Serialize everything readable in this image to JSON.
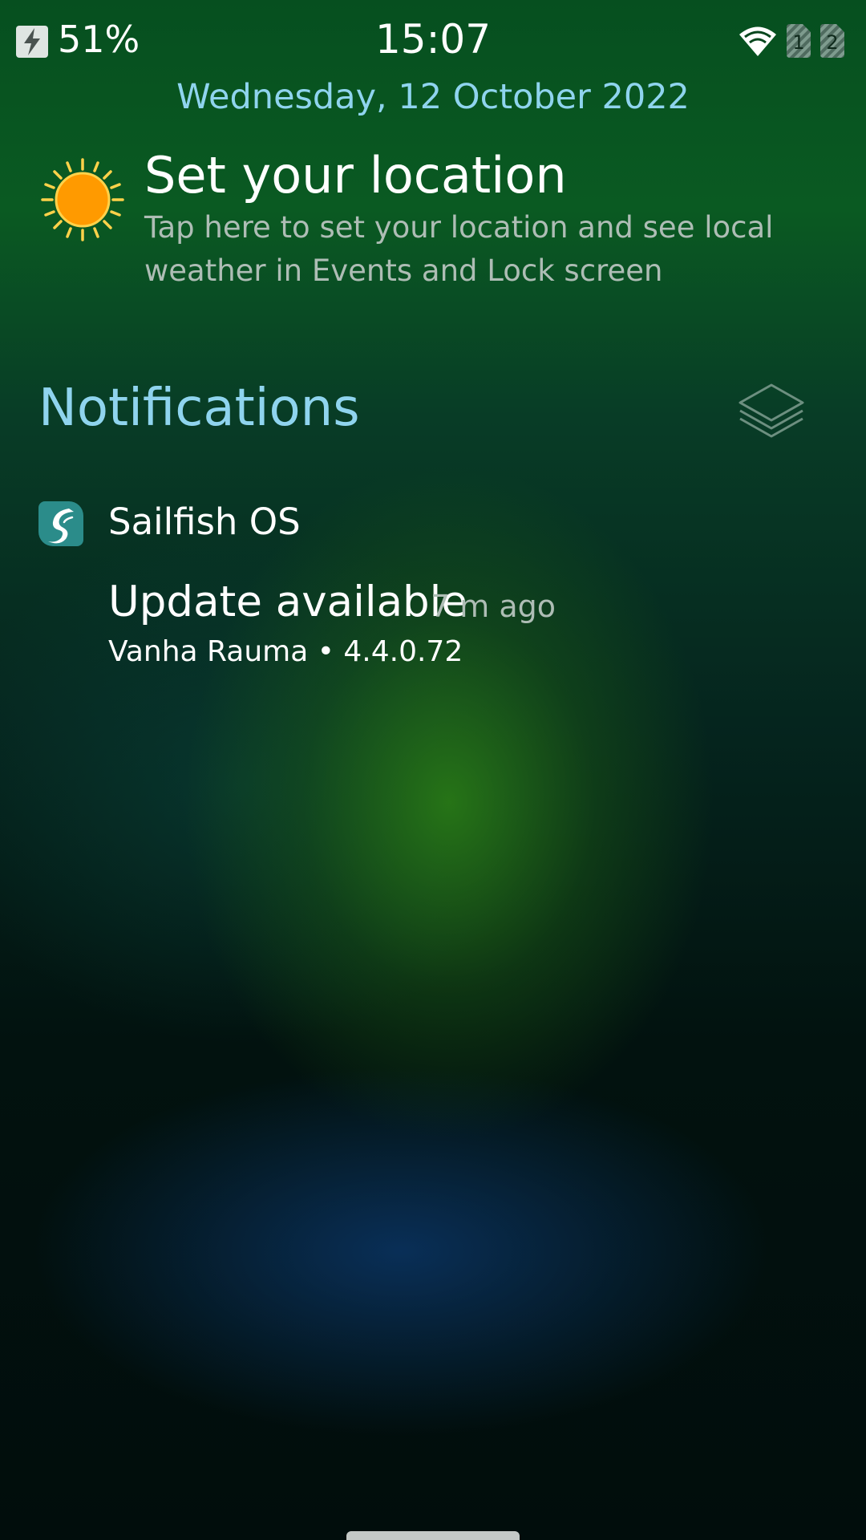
{
  "status_bar": {
    "battery_percent": "51%",
    "clock": "15:07",
    "battery_icon": "charging-bolt-icon",
    "wifi_icon": "wifi-icon",
    "sim_slots": [
      "1",
      "2"
    ]
  },
  "date": "Wednesday, 12 October 2022",
  "location_prompt": {
    "icon": "sun-icon",
    "title": "Set your location",
    "description": "Tap here to set your location and see local weather in Events and Lock screen"
  },
  "notifications": {
    "header": "Notifications",
    "clear_icon": "stacked-layers-icon",
    "groups": [
      {
        "app_name": "Sailfish OS",
        "app_icon": "sailfish-os-icon",
        "items": [
          {
            "title": "Update available",
            "time": "7 m ago",
            "body": "Vanha Rauma • 4.4.0.72"
          }
        ]
      }
    ]
  },
  "colors": {
    "accent": "#8fd4ee",
    "secondary_text": "#aebdb5",
    "sun": "#ff9a00",
    "app_icon_bg": "#2b8c8a"
  }
}
